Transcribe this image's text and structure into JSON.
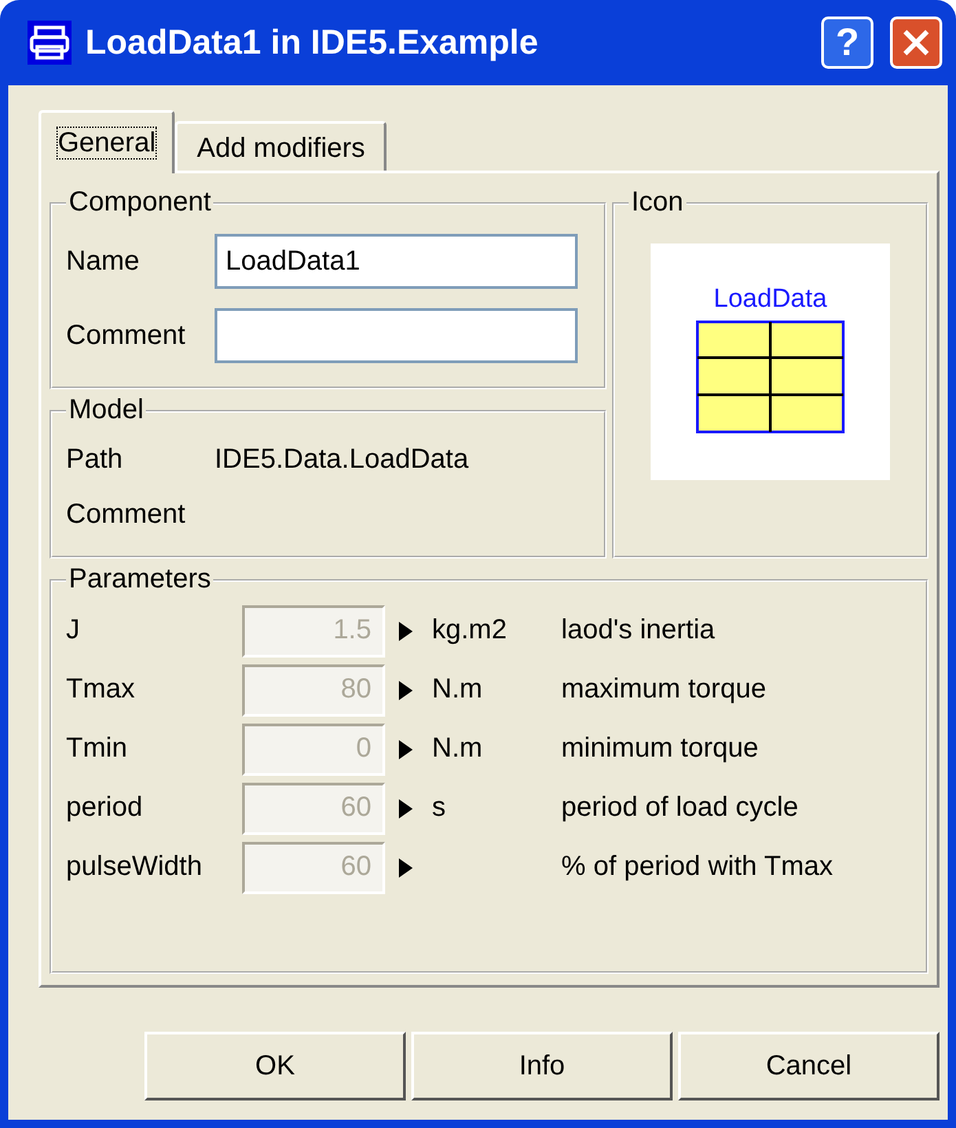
{
  "window": {
    "title": "LoadData1 in IDE5.Example",
    "help_button": "?"
  },
  "tabs": [
    {
      "label": "General",
      "selected": true
    },
    {
      "label": "Add modifiers",
      "selected": false
    }
  ],
  "component": {
    "title": "Component",
    "fields": [
      {
        "label": "Name",
        "value": "LoadData1"
      },
      {
        "label": "Comment"
      }
    ]
  },
  "icon": {
    "title": "Icon",
    "label": "LoadData"
  },
  "model": {
    "title": "Model",
    "rows": [
      {
        "label": "Path",
        "value": "IDE5.Data.LoadData"
      },
      {
        "label": "Comment"
      }
    ]
  },
  "parameters": {
    "title": "Parameters",
    "rows": [
      {
        "name": "J",
        "placeholder": "1.5",
        "unit": "kg.m2",
        "description": "laod's inertia"
      },
      {
        "name": "Tmax",
        "placeholder": "80",
        "unit": "N.m",
        "description": "maximum torque"
      },
      {
        "name": "Tmin",
        "placeholder": "0",
        "unit": "N.m",
        "description": "minimum torque"
      },
      {
        "name": "period",
        "placeholder": "60",
        "unit": "s",
        "description": "period of load cycle"
      },
      {
        "name": "pulseWidth",
        "placeholder": "60",
        "description": "% of period with Tmax"
      }
    ]
  },
  "buttons": [
    "OK",
    "Info",
    "Cancel"
  ]
}
